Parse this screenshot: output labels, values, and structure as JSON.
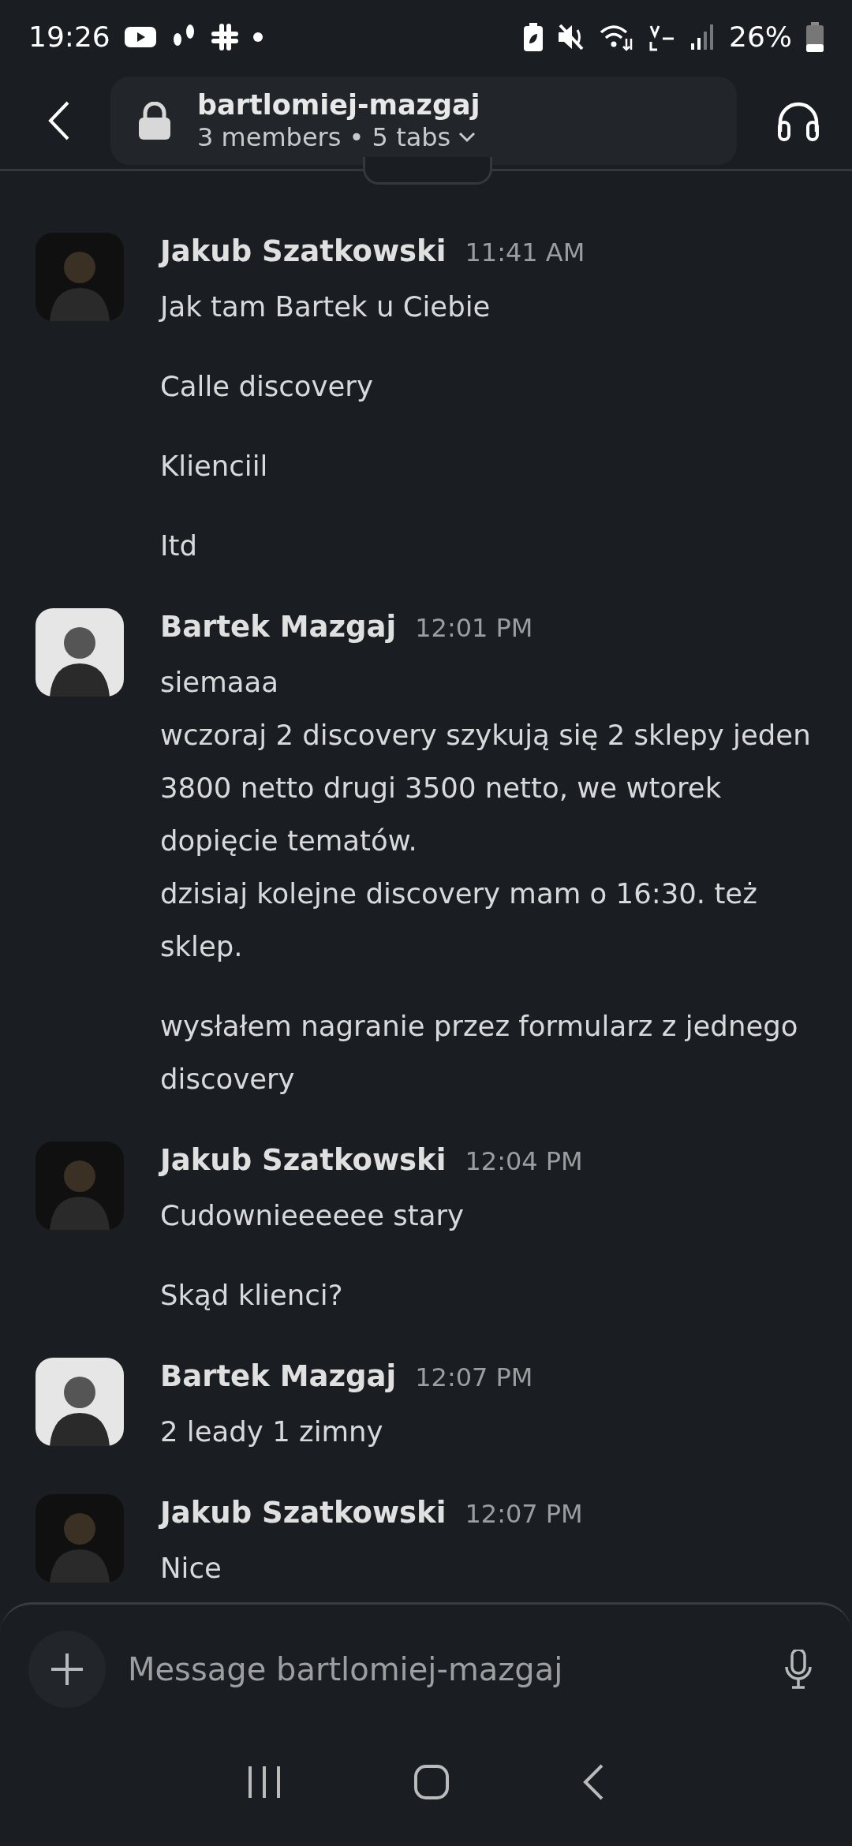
{
  "status_bar": {
    "time": "19:26",
    "battery": "26%"
  },
  "header": {
    "title": "bartlomiej-mazgaj",
    "subtitle": "3 members • 5 tabs"
  },
  "messages": [
    {
      "author": "Jakub Szatkowski",
      "time": "11:41 AM",
      "avatar": {
        "color": "#101010"
      },
      "paragraphs": [
        [
          "Jak tam Bartek u Ciebie"
        ],
        [
          "Calle discovery"
        ],
        [
          "Klienciil"
        ],
        [
          "Itd"
        ]
      ]
    },
    {
      "author": "Bartek Mazgaj",
      "time": "12:01 PM",
      "avatar": {
        "color": "#e6e6e6"
      },
      "paragraphs": [
        [
          "siemaaa",
          "wczoraj 2 discovery szykują się 2 sklepy jeden 3800 netto drugi 3500 netto, we wtorek dopięcie tematów.",
          "dzisiaj kolejne discovery mam o 16:30. też sklep."
        ],
        [
          "wysłałem nagranie przez formularz z jednego discovery"
        ]
      ]
    },
    {
      "author": "Jakub Szatkowski",
      "time": "12:04 PM",
      "avatar": {
        "color": "#101010"
      },
      "paragraphs": [
        [
          "Cudownieeeeee stary"
        ],
        [
          "Skąd klienci?"
        ]
      ]
    },
    {
      "author": "Bartek Mazgaj",
      "time": "12:07 PM",
      "avatar": {
        "color": "#e6e6e6"
      },
      "paragraphs": [
        [
          "2 leady 1 zimny"
        ]
      ]
    },
    {
      "author": "Jakub Szatkowski",
      "time": "12:07 PM",
      "avatar": {
        "color": "#101010"
      },
      "paragraphs": [
        [
          "Nice"
        ]
      ]
    }
  ],
  "composer": {
    "placeholder": "Message bartlomiej-mazgaj"
  }
}
